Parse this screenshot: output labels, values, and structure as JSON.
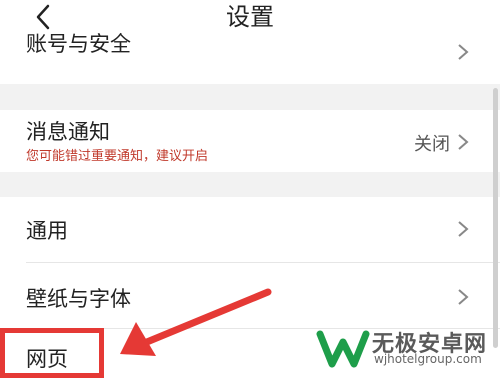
{
  "header": {
    "title": "设置",
    "back_icon": "back-arrow-icon"
  },
  "settings": {
    "account_security": {
      "label": "账号与安全"
    },
    "notifications": {
      "label": "消息通知",
      "subtitle": "您可能错过重要通知，建议开启",
      "value": "关闭"
    },
    "general": {
      "label": "通用"
    },
    "wallpaper_font": {
      "label": "壁纸与字体"
    },
    "web": {
      "label": "网页"
    }
  },
  "annotation": {
    "highlight_color": "#e53935",
    "arrow_icon": "red-arrow-icon"
  },
  "watermark": {
    "main": "无极安卓网",
    "sub": "wjhotelgroup.com",
    "logo_icon": "w-logo-icon"
  },
  "colors": {
    "accent_red": "#c0392b",
    "separator_gray": "#f2f2f2"
  }
}
